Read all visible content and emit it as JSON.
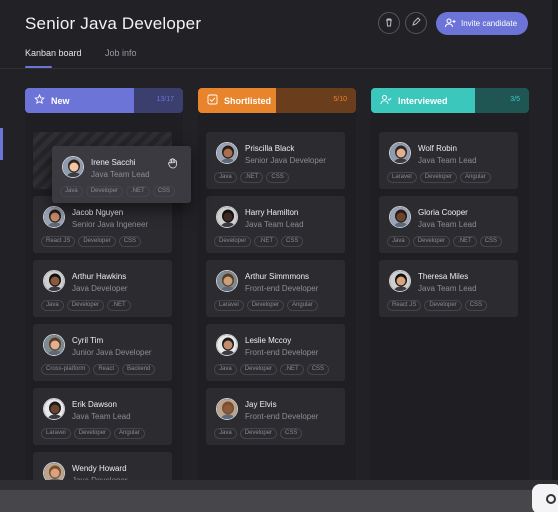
{
  "header": {
    "title": "Senior Java Developer",
    "invite_label": "Invite candidate"
  },
  "tabs": [
    {
      "label": "Kanban board",
      "active": true
    },
    {
      "label": "Job info",
      "active": false
    }
  ],
  "columns": [
    {
      "title": "New",
      "count": "13/17",
      "color_main": "#6d74d8",
      "color_dark": "#3a3f6e",
      "icon": "star-icon",
      "dragging": {
        "name": "Irene Sacchi",
        "role": "Java Team Lead",
        "tags": [
          "Java",
          "Developer",
          ".NET",
          "CSS"
        ]
      },
      "cards": [
        {
          "name": "Jacob Nguyen",
          "role": "Senior Java Ingeneer",
          "tags": [
            "React JS",
            "Developer",
            "CSS"
          ]
        },
        {
          "name": "Arthur Hawkins",
          "role": "Java Developer",
          "tags": [
            "Java",
            "Developer",
            ".NET"
          ]
        },
        {
          "name": "Cyril Tim",
          "role": "Junior Java Developer",
          "tags": [
            "Cross-platform",
            "React",
            "Backend"
          ]
        },
        {
          "name": "Erik Dawson",
          "role": "Java Team Lead",
          "tags": [
            "Laravel",
            "Developer",
            "Angular"
          ]
        },
        {
          "name": "Wendy Howard",
          "role": "Java Developer",
          "tags": []
        }
      ]
    },
    {
      "title": "Shortlisted",
      "count": "5/10",
      "color_main": "#e8842c",
      "color_dark": "#6a3d1c",
      "icon": "checkbox-icon",
      "cards": [
        {
          "name": "Priscilla Black",
          "role": "Senior Java Developer",
          "tags": [
            "Java",
            ".NET",
            "CSS"
          ]
        },
        {
          "name": "Harry Hamilton",
          "role": "Java Team Lead",
          "tags": [
            "Developer",
            ".NET",
            "CSS"
          ]
        },
        {
          "name": "Arthur Simmmons",
          "role": "Front-end Developer",
          "tags": [
            "Laravel",
            "Developer",
            "Angular"
          ]
        },
        {
          "name": "Leslie Mccoy",
          "role": "Front-end Developer",
          "tags": [
            "Java",
            "Developer",
            ".NET",
            "CSS"
          ]
        },
        {
          "name": "Jay Elvis",
          "role": "Front-end Developer",
          "tags": [
            "Java",
            "Developer",
            "CSS"
          ]
        }
      ]
    },
    {
      "title": "Interviewed",
      "count": "3/5",
      "color_main": "#3cc7bd",
      "color_dark": "#1f5552",
      "icon": "user-check-icon",
      "cards": [
        {
          "name": "Wolf Robin",
          "role": "Java Team Lead",
          "tags": [
            "Laravel",
            "Developer",
            "Angular"
          ]
        },
        {
          "name": "Gloria Cooper",
          "role": "Java Team Lead",
          "tags": [
            "Java",
            "Developer",
            ".NET",
            "CSS"
          ]
        },
        {
          "name": "Theresa Miles",
          "role": "Java Team Lead",
          "tags": [
            "React JS",
            "Developer",
            "CSS"
          ]
        }
      ]
    }
  ]
}
